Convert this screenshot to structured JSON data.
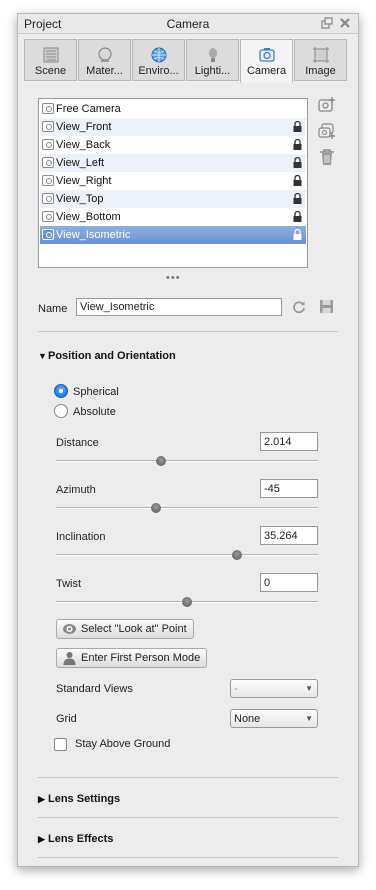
{
  "titlebar": {
    "project": "Project",
    "title": "Camera"
  },
  "tabs": [
    {
      "label": "Scene",
      "icon": "scene-icon"
    },
    {
      "label": "Mater...",
      "icon": "material-icon"
    },
    {
      "label": "Enviro...",
      "icon": "environment-globe-icon"
    },
    {
      "label": "Lighti...",
      "icon": "lightbulb-icon"
    },
    {
      "label": "Camera",
      "icon": "camera-icon",
      "active": true
    },
    {
      "label": "Image",
      "icon": "image-frame-icon"
    }
  ],
  "cameras": [
    {
      "name": "Free Camera",
      "locked": false
    },
    {
      "name": "View_Front",
      "locked": true
    },
    {
      "name": "View_Back",
      "locked": true
    },
    {
      "name": "View_Left",
      "locked": true
    },
    {
      "name": "View_Right",
      "locked": true
    },
    {
      "name": "View_Top",
      "locked": true
    },
    {
      "name": "View_Bottom",
      "locked": true
    },
    {
      "name": "View_Isometric",
      "locked": true,
      "selected": true
    }
  ],
  "name_field": {
    "label": "Name",
    "value": "View_Isometric"
  },
  "position": {
    "header": "Position and Orientation",
    "mode_options": [
      "Spherical",
      "Absolute"
    ],
    "selected_mode": "Spherical",
    "distance": {
      "label": "Distance",
      "value": "2.014",
      "slider": 0.4
    },
    "azimuth": {
      "label": "Azimuth",
      "value": "-45",
      "slider": 0.38
    },
    "inclination": {
      "label": "Inclination",
      "value": "35.264",
      "slider": 0.69
    },
    "twist": {
      "label": "Twist",
      "value": "0",
      "slider": 0.5
    },
    "look_at_button": "Select \"Look at\" Point",
    "first_person_button": "Enter First Person Mode",
    "standard_views": {
      "label": "Standard Views",
      "value": "-"
    },
    "grid": {
      "label": "Grid",
      "value": "None"
    },
    "stay_above_ground": {
      "label": "Stay Above Ground",
      "checked": false
    }
  },
  "lens_settings": {
    "header": "Lens Settings"
  },
  "lens_effects": {
    "header": "Lens Effects"
  }
}
